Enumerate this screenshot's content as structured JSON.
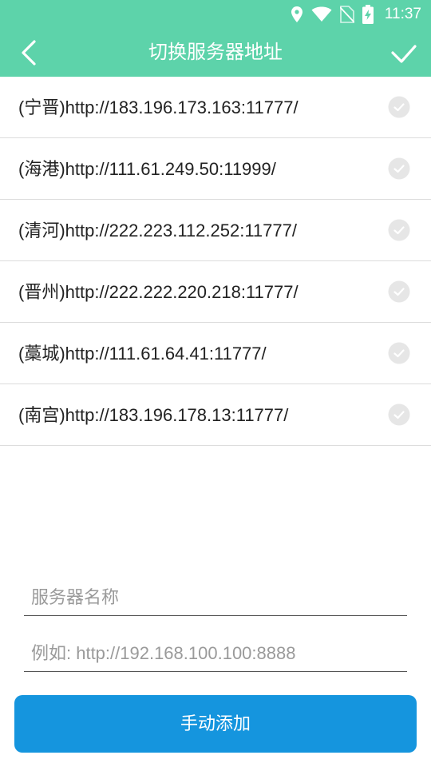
{
  "status_bar": {
    "time": "11:37"
  },
  "header": {
    "title": "切换服务器地址"
  },
  "servers": [
    {
      "label": "(宁晋)http://183.196.173.163:11777/"
    },
    {
      "label": "(海港)http://111.61.249.50:11999/"
    },
    {
      "label": "(清河)http://222.223.112.252:11777/"
    },
    {
      "label": "(晋州)http://222.222.220.218:11777/"
    },
    {
      "label": "(藁城)http://111.61.64.41:11777/"
    },
    {
      "label": "(南宫)http://183.196.178.13:11777/"
    }
  ],
  "form": {
    "name_placeholder": "服务器名称",
    "url_placeholder": "例如: http://192.168.100.100:8888",
    "name_value": "",
    "url_value": ""
  },
  "add_button": {
    "label": "手动添加"
  },
  "colors": {
    "header": "#5dd3aa",
    "button": "#1595de"
  },
  "icons": [
    "location-icon",
    "wifi-icon",
    "no-sim-icon",
    "battery-charging-icon",
    "back-arrow-icon",
    "confirm-check-icon",
    "check-circle-icon"
  ]
}
